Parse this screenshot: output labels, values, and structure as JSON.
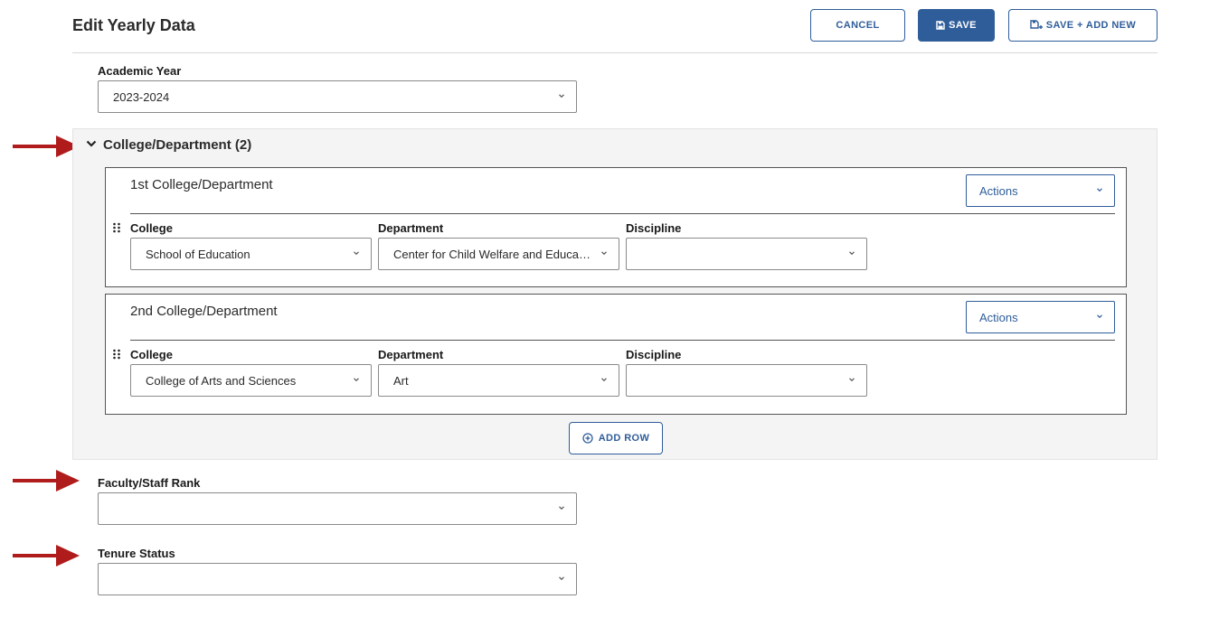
{
  "header": {
    "title": "Edit Yearly Data",
    "cancel_label": "CANCEL",
    "save_label": "SAVE",
    "save_add_new_label": "SAVE + ADD NEW"
  },
  "academic_year": {
    "label": "Academic Year",
    "value": "2023-2024"
  },
  "college_section": {
    "title": "College/Department (2)",
    "add_row_label": "ADD ROW",
    "cards": [
      {
        "title": "1st College/Department",
        "actions_label": "Actions",
        "college_label": "College",
        "college_value": "School of Education",
        "department_label": "Department",
        "department_value": "Center for Child Welfare and Education",
        "discipline_label": "Discipline",
        "discipline_value": ""
      },
      {
        "title": "2nd College/Department",
        "actions_label": "Actions",
        "college_label": "College",
        "college_value": "College of Arts and Sciences",
        "department_label": "Department",
        "department_value": "Art",
        "discipline_label": "Discipline",
        "discipline_value": ""
      }
    ]
  },
  "faculty_rank": {
    "label": "Faculty/Staff Rank",
    "value": ""
  },
  "tenure_status": {
    "label": "Tenure Status",
    "value": ""
  },
  "colors": {
    "primary": "#2f5d9a",
    "annotation_arrow": "#b01c1c",
    "panel_bg": "#f4f4f4"
  }
}
